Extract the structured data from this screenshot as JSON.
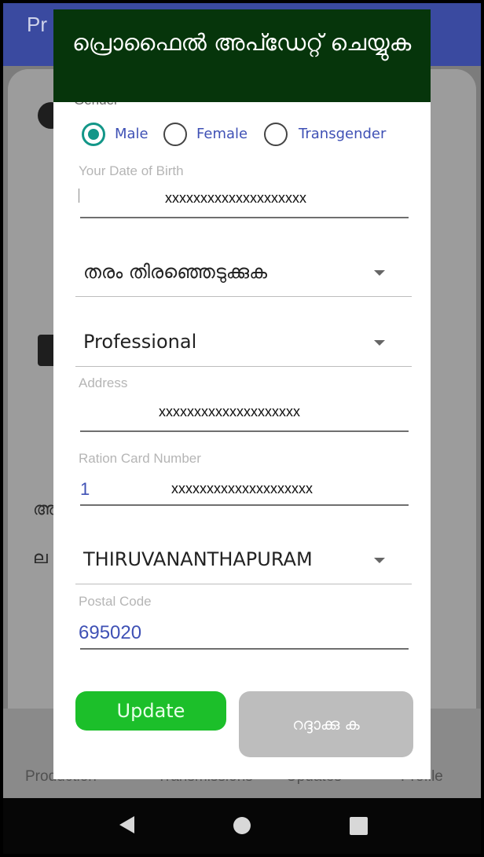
{
  "app": {
    "title": "Pr"
  },
  "background": {
    "nav": [
      "Production",
      "Transmissions",
      "Updates",
      "Profile"
    ],
    "fragments": [
      "അ",
      "ല"
    ]
  },
  "dialog": {
    "title": "പ്രൊഫൈൽ അപ്ഡേറ്റ് ചെയ്യുക",
    "gender": {
      "label": "Gender",
      "options": [
        "Male",
        "Female",
        "Transgender"
      ],
      "selected": "Male"
    },
    "dob": {
      "label": "Your Date of Birth",
      "value": "xxxxxxxxxxxxxxxxxxxx"
    },
    "category_dropdown": {
      "value": "തരം തിരഞ്ഞെടുക്കുക"
    },
    "profession_dropdown": {
      "value": "Professional"
    },
    "address": {
      "label": "Address",
      "value": "xxxxxxxxxxxxxxxxxxxx"
    },
    "ration_card": {
      "label": "Ration Card Number",
      "prefix": "1",
      "value": "xxxxxxxxxxxxxxxxxxxx"
    },
    "district_dropdown": {
      "value": "THIRUVANANTHAPURAM"
    },
    "postal_code": {
      "label": "Postal Code",
      "value": "695020"
    },
    "buttons": {
      "update": "Update",
      "cancel": "റദ്ദാക്കു ക"
    }
  },
  "colors": {
    "header_bg": "#06350b",
    "accent_teal": "#129688",
    "label_blue": "#3f51b5",
    "update_green": "#1cbf2a",
    "cancel_gray": "#bdbdbd"
  }
}
